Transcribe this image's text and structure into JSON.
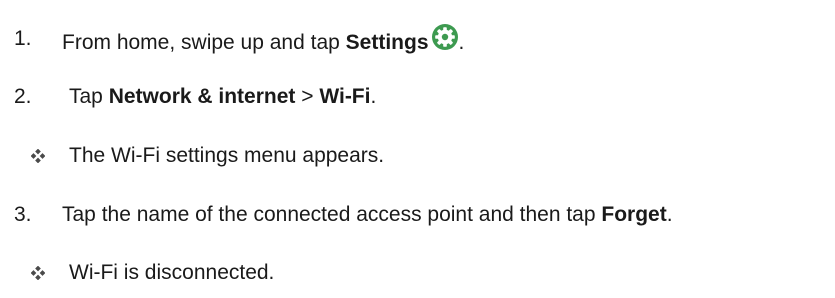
{
  "steps": [
    {
      "number": "1.",
      "parts": [
        "From home, swipe up and tap ",
        "Settings",
        "."
      ],
      "icon": "settings-gear-icon",
      "icon_color": "#3d9a50"
    },
    {
      "number": "2.",
      "parts": [
        "Tap ",
        "Network & internet",
        " > ",
        "Wi-Fi",
        "."
      ]
    },
    {
      "number": "3.",
      "parts": [
        "Tap the name of the connected access point and then tap ",
        "Forget",
        "."
      ]
    }
  ],
  "results": [
    {
      "icon": "diamond-bullet-icon",
      "text": "The Wi-Fi settings menu appears."
    },
    {
      "icon": "diamond-bullet-icon",
      "text": "Wi-Fi is disconnected."
    }
  ]
}
